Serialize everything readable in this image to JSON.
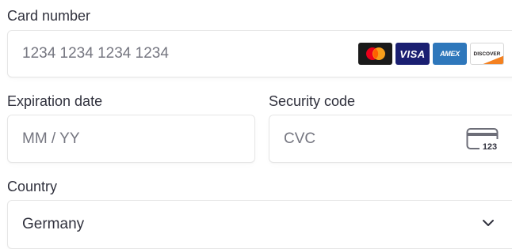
{
  "card_number": {
    "label": "Card number",
    "placeholder": "1234 1234 1234 1234",
    "brands": [
      {
        "name": "mastercard-icon",
        "text": ""
      },
      {
        "name": "visa-icon",
        "text": "VISA"
      },
      {
        "name": "amex-icon",
        "text": "AMEX"
      },
      {
        "name": "discover-icon",
        "text": "DISCOVER"
      }
    ]
  },
  "expiration": {
    "label": "Expiration date",
    "placeholder": "MM / YY"
  },
  "security": {
    "label": "Security code",
    "placeholder": "CVC",
    "icon_text": "123"
  },
  "country": {
    "label": "Country",
    "value": "Germany"
  }
}
